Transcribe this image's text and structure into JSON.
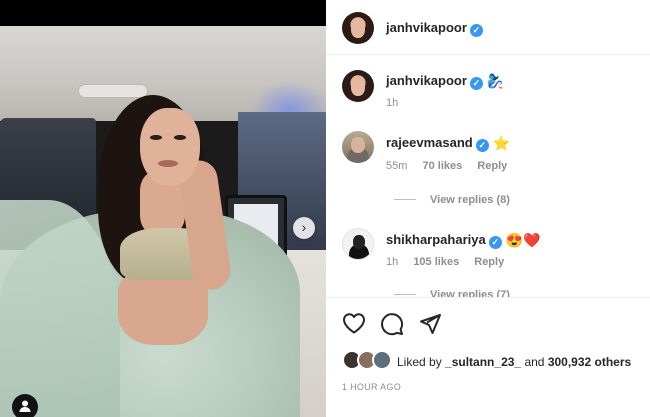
{
  "post": {
    "author": "janhvikapoor"
  },
  "caption": {
    "username": "janhvikapoor",
    "emoji": "🧞‍♀️",
    "time": "1h"
  },
  "comments": [
    {
      "username": "rajeevmasand",
      "emoji": "⭐",
      "time": "55m",
      "likes": "70 likes",
      "reply_label": "Reply",
      "view_replies": "View replies (8)"
    },
    {
      "username": "shikharpahariya",
      "emoji": "😍❤️",
      "time": "1h",
      "likes": "105 likes",
      "reply_label": "Reply",
      "view_replies": "View replies (7)"
    }
  ],
  "actions": {
    "like_icon": "heart-icon",
    "comment_icon": "comment-icon",
    "share_icon": "share-icon"
  },
  "likes_summary": {
    "prefix": "Liked by",
    "user": "_sultann_23_",
    "connector": "and",
    "others": "300,932 others"
  },
  "timestamp": "1 HOUR AGO",
  "colors": {
    "verified": "#3897f0",
    "muted_text": "#8e8e8e",
    "primary_text": "#262626"
  }
}
